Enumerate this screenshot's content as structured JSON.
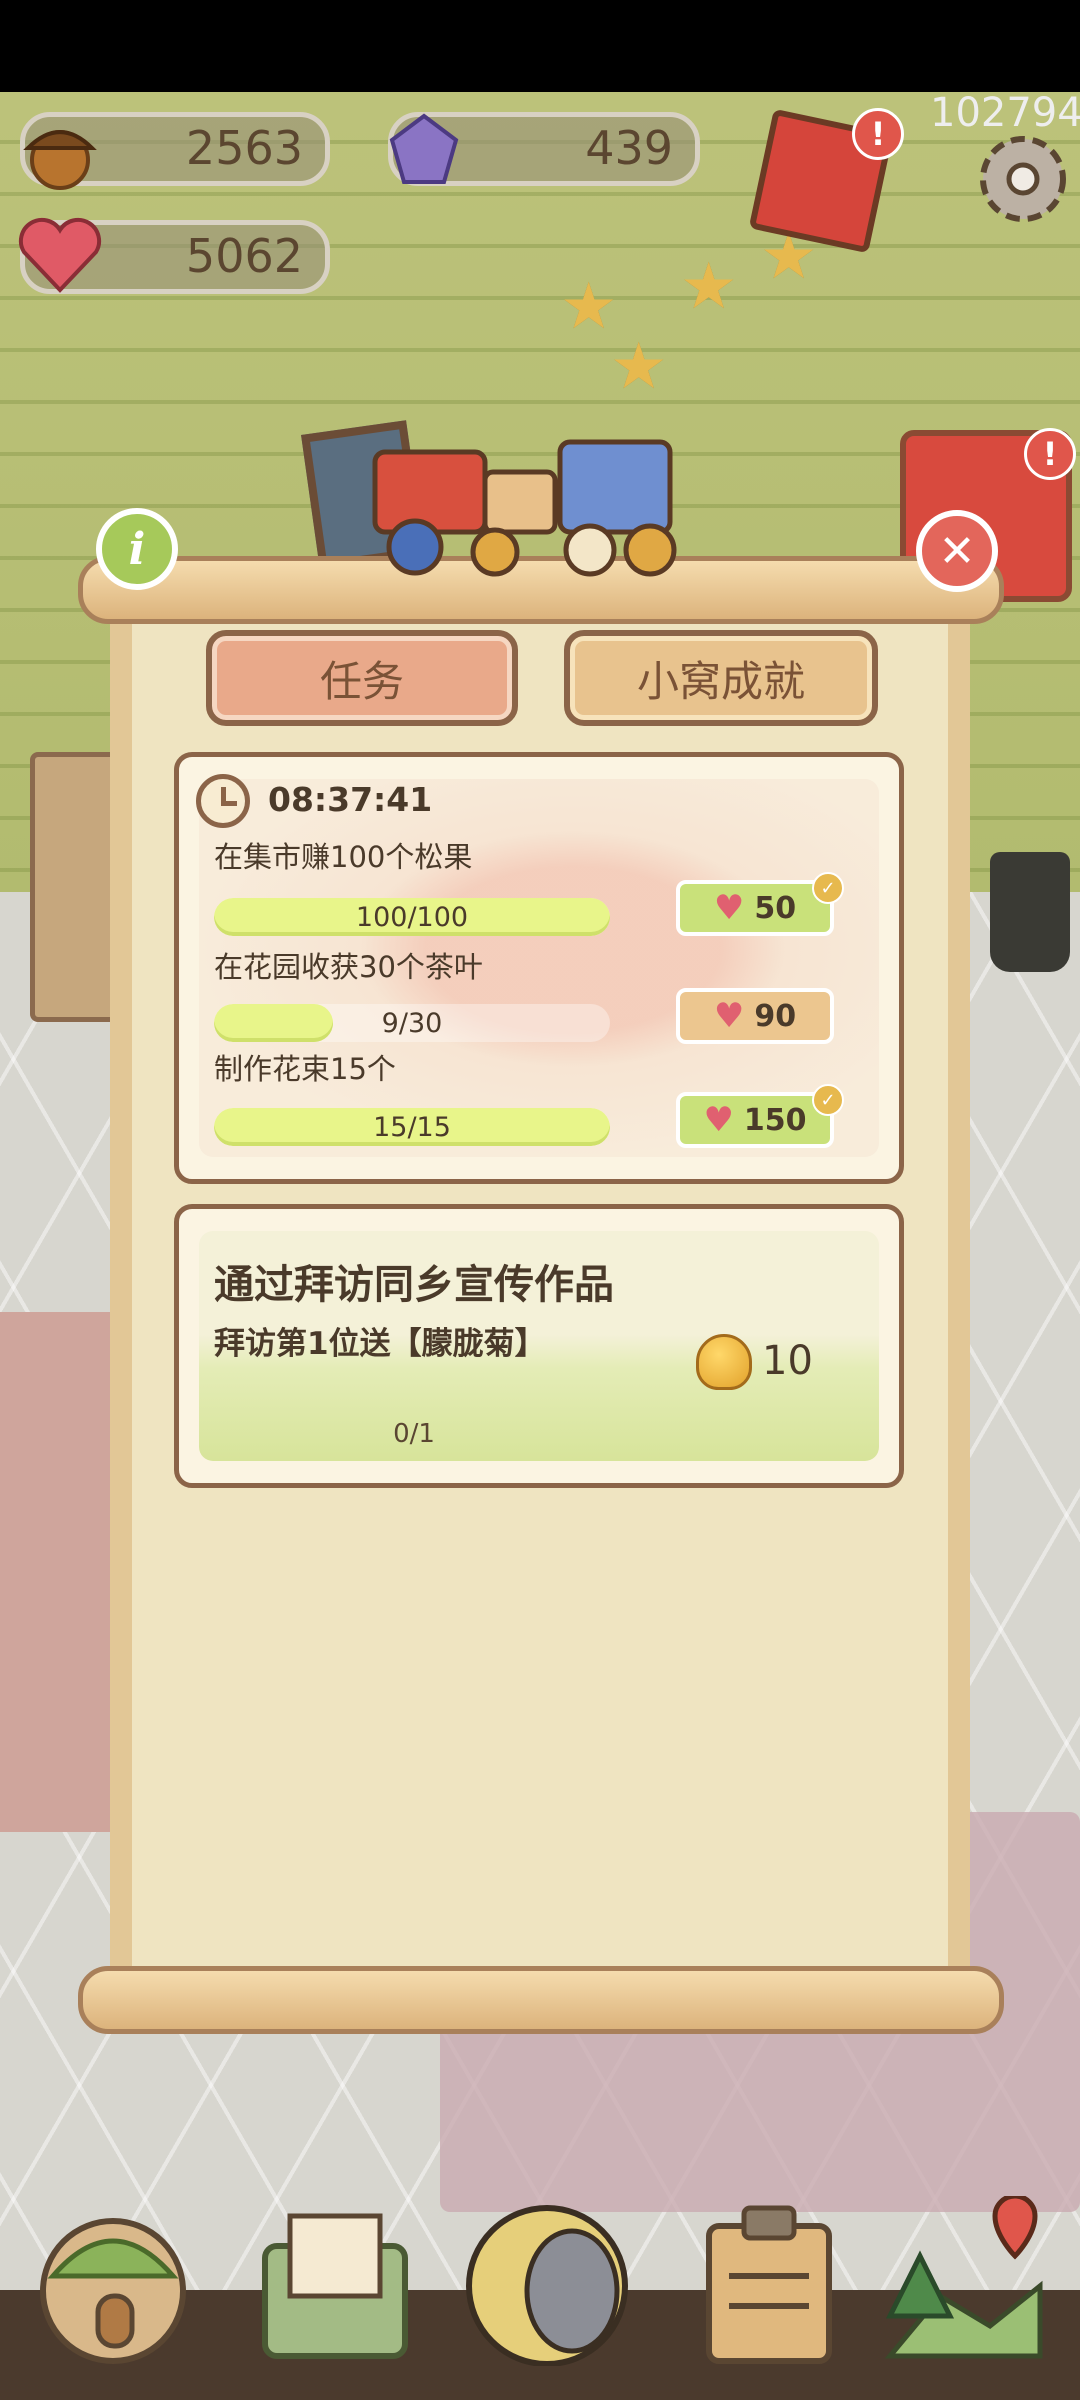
{
  "hud": {
    "acorn": {
      "value": "2563",
      "icon": "acorn-icon"
    },
    "gem": {
      "value": "439",
      "icon": "gem-icon"
    },
    "hearts": {
      "value": "5062",
      "icon": "heart-icon"
    },
    "corner_id": "102794"
  },
  "dialog": {
    "tabs": [
      {
        "label": "任务",
        "active": true
      },
      {
        "label": "小窝成就",
        "active": false
      }
    ],
    "daily": {
      "timer": "08:37:41",
      "tasks": [
        {
          "label": "在集市赚100个松果",
          "progress": "100/100",
          "fraction": 1.0,
          "reward": "50",
          "done": true
        },
        {
          "label": "在花园收获30个茶叶",
          "progress": "9/30",
          "fraction": 0.3,
          "reward": "90",
          "done": false
        },
        {
          "label": "制作花束15个",
          "progress": "15/15",
          "fraction": 1.0,
          "reward": "150",
          "done": true
        }
      ]
    },
    "event": {
      "title": "通过拜访同乡宣传作品",
      "subtitle": "拜访第1位送【朦胧菊】",
      "progress": "0/1",
      "reward": "10",
      "reward_icon": "bell-icon"
    }
  },
  "colors": {
    "accent_green": "#c9e17a",
    "accent_orange": "#ecc68f",
    "close_red": "#e3665b"
  }
}
